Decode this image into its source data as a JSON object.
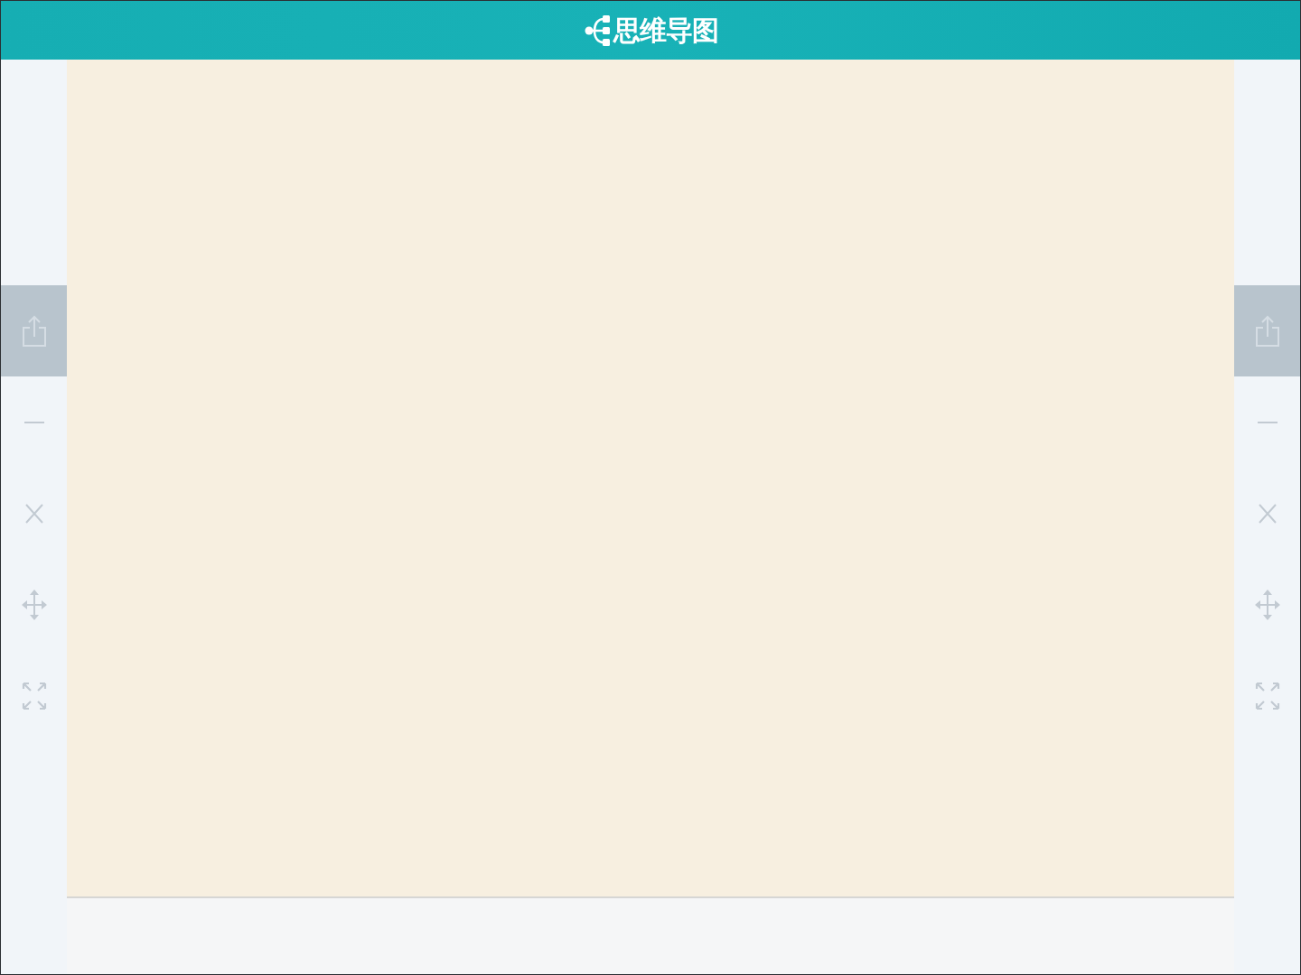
{
  "header": {
    "title": "思维导图"
  },
  "left_toolbar": {
    "buttons": [
      {
        "kind": "share",
        "selected": true
      },
      {
        "kind": "minus",
        "selected": false
      },
      {
        "kind": "close",
        "selected": false
      },
      {
        "kind": "move",
        "selected": false
      },
      {
        "kind": "fullscreen",
        "selected": false
      }
    ]
  },
  "right_toolbar": {
    "buttons": [
      {
        "kind": "share",
        "selected": true
      },
      {
        "kind": "minus",
        "selected": false
      },
      {
        "kind": "close",
        "selected": false
      },
      {
        "kind": "move",
        "selected": false
      },
      {
        "kind": "fullscreen",
        "selected": false
      }
    ]
  }
}
